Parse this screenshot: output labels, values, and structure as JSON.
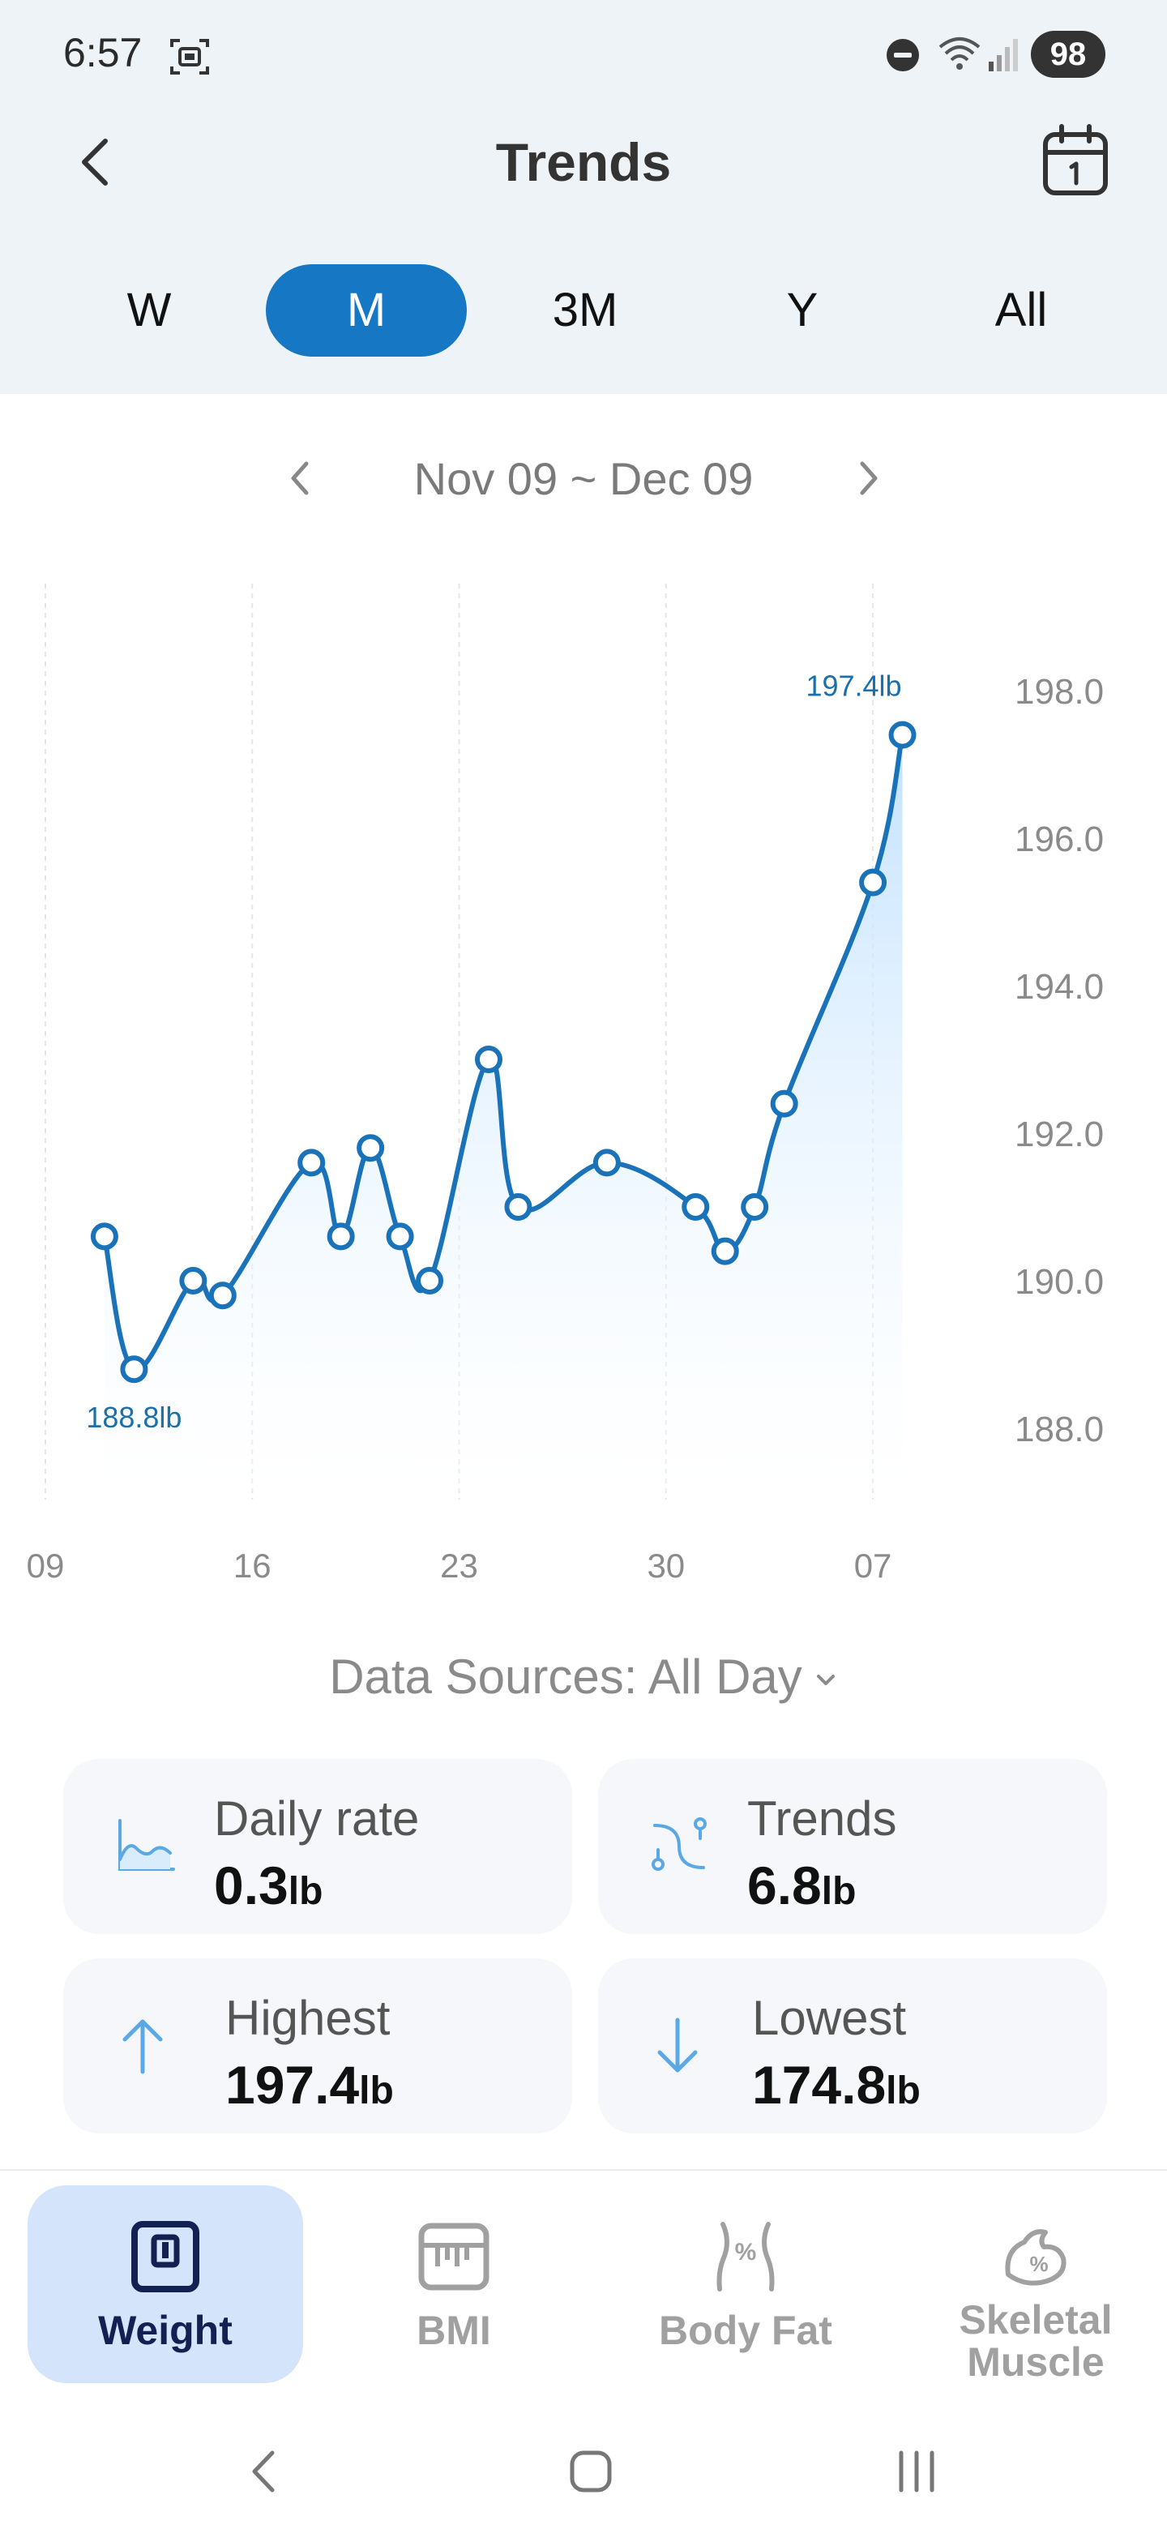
{
  "status": {
    "time": "6:57",
    "battery": "98"
  },
  "header": {
    "title": "Trends"
  },
  "periods": [
    {
      "label": "W",
      "active": false
    },
    {
      "label": "M",
      "active": true
    },
    {
      "label": "3M",
      "active": false
    },
    {
      "label": "Y",
      "active": false
    },
    {
      "label": "All",
      "active": false
    }
  ],
  "range": {
    "label": "Nov 09 ~ Dec 09"
  },
  "chart_data": {
    "type": "line",
    "unit": "lb",
    "x_tick_labels": [
      "09",
      "16",
      "23",
      "30",
      "07"
    ],
    "y_tick_labels": [
      "198.0",
      "196.0",
      "194.0",
      "192.0",
      "190.0",
      "188.0"
    ],
    "ylim": [
      187,
      199
    ],
    "x_range_days": [
      0,
      30
    ],
    "x_label": "",
    "y_label": "",
    "grid": "vertical dashed",
    "series": [
      {
        "x_days": [
          2,
          3,
          5,
          6,
          9,
          10,
          11,
          12,
          13,
          15,
          16,
          19,
          22,
          23,
          24,
          25,
          28,
          29
        ],
        "values": [
          190.6,
          188.8,
          190.0,
          189.8,
          191.6,
          190.6,
          191.8,
          190.6,
          190.0,
          193.0,
          191.0,
          191.6,
          191.0,
          190.4,
          191.0,
          192.4,
          195.4,
          197.4
        ]
      }
    ],
    "annotations": [
      {
        "text": "197.4lb",
        "point_index": 17
      },
      {
        "text": "188.8lb",
        "point_index": 1
      }
    ],
    "colors": {
      "line": "#1a73b8",
      "fill": "#cfe8ff"
    }
  },
  "data_source": {
    "label": "Data Sources: All Day"
  },
  "stats": [
    {
      "label": "Daily rate",
      "value": "0.3",
      "unit": "lb"
    },
    {
      "label": "Trends",
      "value": "6.8",
      "unit": "lb"
    },
    {
      "label": "Highest",
      "value": "197.4",
      "unit": "lb"
    },
    {
      "label": "Lowest",
      "value": "174.8",
      "unit": "lb"
    }
  ],
  "bottom_nav": [
    {
      "label": "Weight",
      "active": true
    },
    {
      "label": "BMI",
      "active": false
    },
    {
      "label": "Body Fat",
      "active": false
    },
    {
      "label": "Skeletal Muscle",
      "active": false
    }
  ],
  "colors": {
    "accent": "#1677c4",
    "header_bg": "#eef3f8",
    "card_bg": "#f5f7fa",
    "nav_active_bg": "#d4e4fb",
    "icon_blue": "#5aa9e6"
  }
}
